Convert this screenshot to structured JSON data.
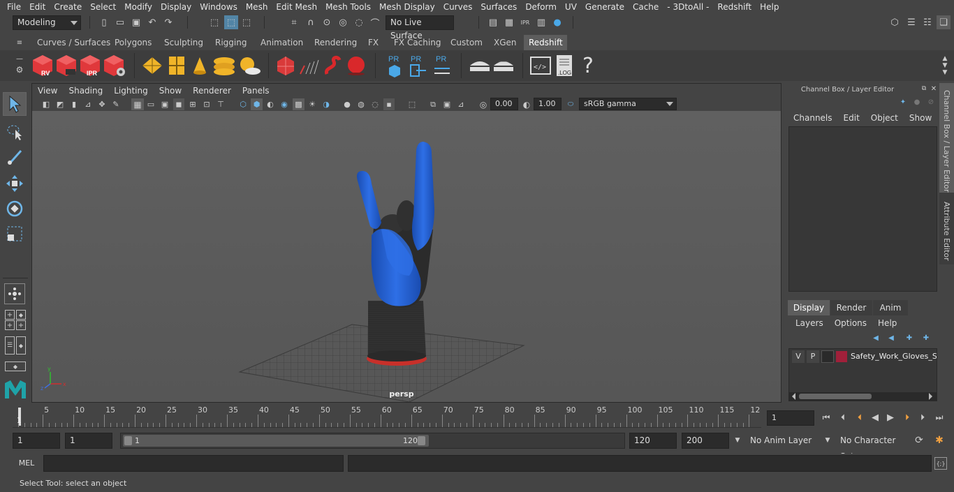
{
  "menubar": {
    "items": [
      "File",
      "Edit",
      "Create",
      "Select",
      "Modify",
      "Display",
      "Windows",
      "Mesh",
      "Edit Mesh",
      "Mesh Tools",
      "Mesh Display",
      "Curves",
      "Surfaces",
      "Deform",
      "UV",
      "Generate",
      "Cache",
      "- 3DtoAll -",
      "Redshift",
      "Help"
    ]
  },
  "statusline": {
    "workspace": "Modeling",
    "live_surface": "No Live Surface"
  },
  "shelf": {
    "tabs": [
      "Curves / Surfaces",
      "Polygons",
      "Sculpting",
      "Rigging",
      "Animation",
      "Rendering",
      "FX",
      "FX Caching",
      "Custom",
      "XGen",
      "Redshift"
    ],
    "active_tab": "Redshift",
    "icon_labels": {
      "rv": "RV",
      "ipr": "IPR",
      "pr": "PR",
      "log": ".LOG"
    }
  },
  "viewport": {
    "menus": [
      "View",
      "Shading",
      "Lighting",
      "Show",
      "Renderer",
      "Panels"
    ],
    "exposure": "0.00",
    "gamma": "1.00",
    "color_space": "sRGB gamma",
    "camera_label": "persp"
  },
  "channel_box": {
    "title": "Channel Box / Layer Editor",
    "menus": [
      "Channels",
      "Edit",
      "Object",
      "Show"
    ]
  },
  "layer_editor": {
    "tabs": [
      "Display",
      "Render",
      "Anim"
    ],
    "active_tab": "Display",
    "menus": [
      "Layers",
      "Options",
      "Help"
    ],
    "layer": {
      "v": "V",
      "p": "P",
      "name": "Safety_Work_Gloves_Si",
      "color": "#a0203a"
    }
  },
  "side_tabs": [
    "Channel Box / Layer Editor",
    "Attribute Editor"
  ],
  "timeline": {
    "ticks": [
      "5",
      "10",
      "15",
      "20",
      "25",
      "30",
      "35",
      "40",
      "45",
      "50",
      "55",
      "60",
      "65",
      "70",
      "75",
      "80",
      "85",
      "90",
      "95",
      "100",
      "105",
      "110",
      "115",
      "12"
    ],
    "current_frame_marker": "1",
    "current_frame": "1"
  },
  "range": {
    "start": "1",
    "playback_start": "1",
    "slider_start": "1",
    "slider_end": "120",
    "playback_end": "120",
    "end": "200",
    "anim_layer": "No Anim Layer",
    "character_set": "No Character Set"
  },
  "command": {
    "language": "MEL"
  },
  "help": {
    "text": "Select Tool: select an object"
  },
  "colors": {
    "glove_blue": "#1f5fd1",
    "glove_black": "#2a2a2a",
    "cuff_red": "#c8302a",
    "redshift_red": "#e0383b",
    "gold": "#f0b429",
    "pr_blue": "#4aa8e8"
  }
}
